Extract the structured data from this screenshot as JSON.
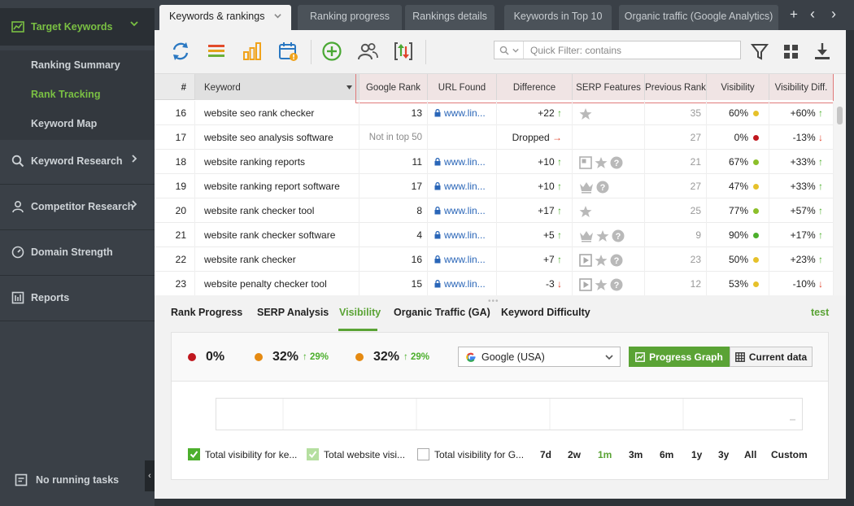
{
  "sidebar": {
    "sections": [
      {
        "label": "Target Keywords",
        "icon": "line-chart-icon",
        "active": true
      },
      {
        "label": "Keyword Research",
        "icon": "search-icon"
      },
      {
        "label": "Competitor Research",
        "icon": "user-icon"
      },
      {
        "label": "Domain Strength",
        "icon": "gauge-icon"
      },
      {
        "label": "Reports",
        "icon": "report-icon"
      }
    ],
    "sub_items": [
      {
        "label": "Ranking Summary"
      },
      {
        "label": "Rank Tracking",
        "active": true
      },
      {
        "label": "Keyword Map"
      }
    ],
    "tasks_label": "No running tasks",
    "collapse_glyph": "‹"
  },
  "tabs": [
    {
      "label": "Keywords & rankings",
      "active": true
    },
    {
      "label": "Ranking progress"
    },
    {
      "label": "Rankings details"
    },
    {
      "label": "Keywords in Top 10"
    },
    {
      "label": "Organic traffic (Google Analytics)"
    }
  ],
  "tab_controls": {
    "add": "+",
    "prev": "‹",
    "next": "›"
  },
  "toolbar": {
    "filter_placeholder": "Quick Filter: contains",
    "icons": [
      "refresh-icon",
      "list-icon",
      "bar-chart-icon",
      "calendar-alert-icon",
      "add-icon",
      "users-icon",
      "sort-updown-icon",
      "filter-icon",
      "grid-icon",
      "download-icon"
    ]
  },
  "table": {
    "columns": [
      "#",
      "Keyword",
      "Google Rank",
      "URL Found",
      "Difference",
      "SERP Features",
      "Previous Rank",
      "Visibility",
      "Visibility Diff."
    ],
    "rows": [
      {
        "num": "16",
        "keyword": "website seo rank checker",
        "rank": "13",
        "url": "www.lin...",
        "diff": "+22",
        "diff_dir": "up",
        "serp": [
          "star"
        ],
        "prev": "35",
        "vis": "60%",
        "vis_color": "#e6c12a",
        "vdiff": "+60%",
        "vdiff_dir": "up"
      },
      {
        "num": "17",
        "keyword": "website seo analysis software",
        "rank": "Not in top 50",
        "rank_na": true,
        "url": "",
        "diff": "Dropped",
        "diff_dir": "right",
        "serp": [],
        "prev": "27",
        "vis": "0%",
        "vis_color": "#c0171e",
        "vdiff": "-13%",
        "vdiff_dir": "down"
      },
      {
        "num": "18",
        "keyword": "website ranking reports",
        "rank": "11",
        "url": "www.lin...",
        "diff": "+10",
        "diff_dir": "up",
        "serp": [
          "snippet",
          "star",
          "question"
        ],
        "prev": "21",
        "vis": "67%",
        "vis_color": "#8cbf2a",
        "vdiff": "+33%",
        "vdiff_dir": "up"
      },
      {
        "num": "19",
        "keyword": "website ranking report software",
        "rank": "17",
        "url": "www.lin...",
        "diff": "+10",
        "diff_dir": "up",
        "serp": [
          "crown",
          "question"
        ],
        "prev": "27",
        "vis": "47%",
        "vis_color": "#e6c12a",
        "vdiff": "+33%",
        "vdiff_dir": "up"
      },
      {
        "num": "20",
        "keyword": "website rank checker tool",
        "rank": "8",
        "url": "www.lin...",
        "diff": "+17",
        "diff_dir": "up",
        "serp": [
          "star"
        ],
        "prev": "25",
        "vis": "77%",
        "vis_color": "#8cbf2a",
        "vdiff": "+57%",
        "vdiff_dir": "up"
      },
      {
        "num": "21",
        "keyword": "website rank checker software",
        "rank": "4",
        "url": "www.lin...",
        "diff": "+5",
        "diff_dir": "up",
        "serp": [
          "crown",
          "star",
          "question"
        ],
        "prev": "9",
        "vis": "90%",
        "vis_color": "#4caf2c",
        "vdiff": "+17%",
        "vdiff_dir": "up"
      },
      {
        "num": "22",
        "keyword": "website rank checker",
        "rank": "16",
        "url": "www.lin...",
        "diff": "+7",
        "diff_dir": "up",
        "serp": [
          "video",
          "star",
          "question"
        ],
        "prev": "23",
        "vis": "50%",
        "vis_color": "#e6c12a",
        "vdiff": "+23%",
        "vdiff_dir": "up"
      },
      {
        "num": "23",
        "keyword": "website penalty checker tool",
        "rank": "15",
        "url": "www.lin...",
        "diff": "-3",
        "diff_dir": "down",
        "serp": [
          "video",
          "star",
          "question"
        ],
        "prev": "12",
        "vis": "53%",
        "vis_color": "#e6c12a",
        "vdiff": "-10%",
        "vdiff_dir": "down"
      }
    ]
  },
  "bottom": {
    "tabs": [
      {
        "label": "Rank Progress"
      },
      {
        "label": "SERP Analysis"
      },
      {
        "label": "Visibility",
        "active": true
      },
      {
        "label": "Organic Traffic (GA)"
      },
      {
        "label": "Keyword Difficulty"
      }
    ],
    "right_link": "test",
    "stats": [
      {
        "value": "0%",
        "color": "#c0171e",
        "delta": ""
      },
      {
        "value": "32%",
        "color": "#e58a12",
        "delta": "29%"
      },
      {
        "value": "32%",
        "color": "#e58a12",
        "delta": "29%"
      }
    ],
    "engine": "Google (USA)",
    "engine_icon": "google-icon",
    "progress_graph_label": "Progress Graph",
    "current_data_label": "Current data",
    "legend": [
      {
        "label": "Total visibility for ke...",
        "state": "checked",
        "color": "#4caf2c"
      },
      {
        "label": "Total website visi...",
        "state": "checked-light",
        "color": "#b5dfa0"
      },
      {
        "label": "Total visibility for G...",
        "state": "unchecked",
        "color": "#ffffff"
      }
    ],
    "periods": [
      {
        "label": "7d"
      },
      {
        "label": "2w"
      },
      {
        "label": "1m",
        "active": true
      },
      {
        "label": "3m"
      },
      {
        "label": "6m"
      },
      {
        "label": "1y"
      },
      {
        "label": "3y"
      },
      {
        "label": "All"
      },
      {
        "label": "Custom"
      }
    ]
  }
}
